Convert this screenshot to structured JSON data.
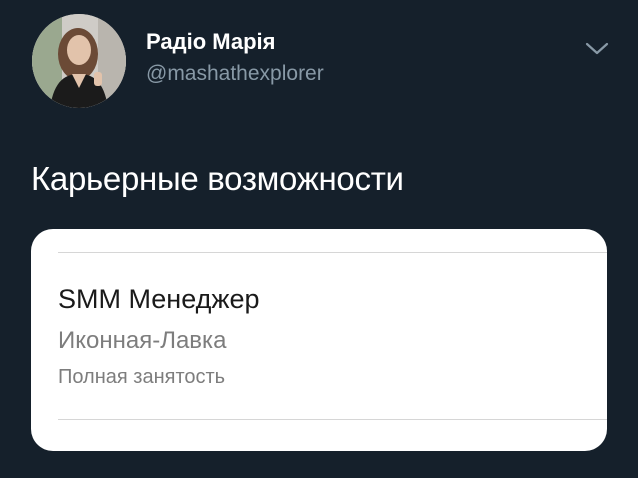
{
  "tweet": {
    "author": {
      "display_name": "Радіо Марія",
      "handle": "@mashathexplorer",
      "avatar_icon": "avatar-photo-icon"
    },
    "menu_icon": "chevron-down-icon",
    "text": "Карьерные возможности"
  },
  "job_card": {
    "title": "SMM Менеджер",
    "company": "Иконная-Лавка",
    "employment_type": "Полная занятость"
  },
  "colors": {
    "background": "#15202b",
    "primary_text": "#ffffff",
    "secondary_text": "#8899a6",
    "card_background": "#ffffff",
    "card_muted_text": "#7d7d7d"
  }
}
